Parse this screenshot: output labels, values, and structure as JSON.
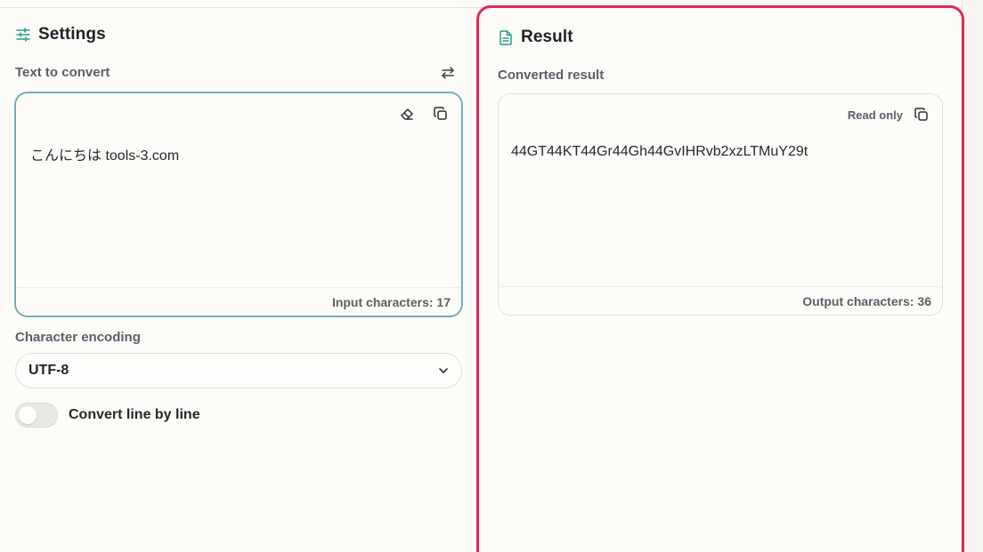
{
  "settings": {
    "title": "Settings",
    "input_label": "Text to convert",
    "input_text": "こんにちは tools-3.com",
    "input_count": "Input characters: 17",
    "encoding_label": "Character encoding",
    "encoding_value": "UTF-8",
    "toggle_label": "Convert line by line",
    "toggle_on": false
  },
  "result": {
    "title": "Result",
    "output_label": "Converted result",
    "readonly_label": "Read only",
    "output_text": "44GT44KT44Gr44Gh44GvIHRvb2xzLTMuY29t",
    "output_count": "Output characters: 36"
  },
  "colors": {
    "accent_teal": "#2a9d8f",
    "result_border": "#dc2a55",
    "input_focus_border": "#6fa8b2"
  },
  "icons": {
    "settings_icon": "sliders-icon",
    "swap_icon": "swap-arrows-icon",
    "clear_icon": "eraser-icon",
    "copy_icon": "copy-icon",
    "result_icon": "document-icon",
    "dropdown_icon": "chevron-down-icon"
  }
}
